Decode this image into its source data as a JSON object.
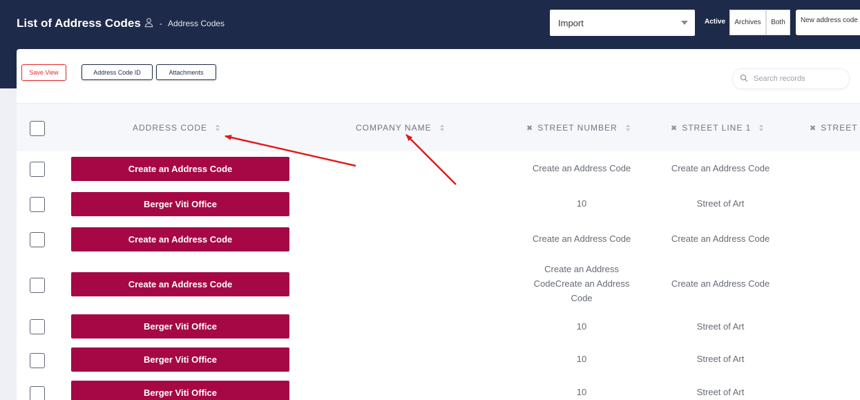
{
  "header": {
    "title": "List of Address Codes",
    "breadcrumb_separator": "-",
    "breadcrumb_current": "Address Codes",
    "import_selected": "Import",
    "filter_active": "Active",
    "filter_archives": "Archives",
    "filter_both": "Both",
    "new_address_code": "New address code"
  },
  "toolbar": {
    "save_view": "Save View",
    "column_address_code_id": "Address Code ID",
    "column_attachments": "Attachments",
    "search_placeholder": "Search records"
  },
  "table": {
    "columns": [
      "ADDRESS CODE",
      "COMPANY NAME",
      "STREET NUMBER",
      "STREET LINE 1",
      "STREET L"
    ],
    "rows": [
      {
        "code": "Create an Address Code",
        "company": "",
        "street_number": "Create an Address Code",
        "street_line1": "Create an Address Code"
      },
      {
        "code": "Berger Viti Office",
        "company": "",
        "street_number": "10",
        "street_line1": "Street of Art"
      },
      {
        "code": "Create an Address Code",
        "company": "",
        "street_number": "Create an Address Code",
        "street_line1": "Create an Address Code"
      },
      {
        "code": "Create an Address Code",
        "company": "",
        "street_number": "Create an Address CodeCreate an Address Code",
        "street_line1": "Create an Address Code"
      },
      {
        "code": "Berger Viti Office",
        "company": "",
        "street_number": "10",
        "street_line1": "Street of Art"
      },
      {
        "code": "Berger Viti Office",
        "company": "",
        "street_number": "10",
        "street_line1": "Street of Art"
      },
      {
        "code": "Berger Viti Office",
        "company": "",
        "street_number": "10",
        "street_line1": "Street of Art"
      }
    ]
  },
  "colors": {
    "header_bg": "#1e2a49",
    "code_button": "#a50845",
    "save_view_border": "#e22a2a",
    "annotation_arrow": "#e11a1a"
  },
  "icons": [
    "user-icon",
    "chevron-down-icon",
    "search-icon",
    "sort-icon",
    "remove-column-icon",
    "annotation-arrow"
  ]
}
